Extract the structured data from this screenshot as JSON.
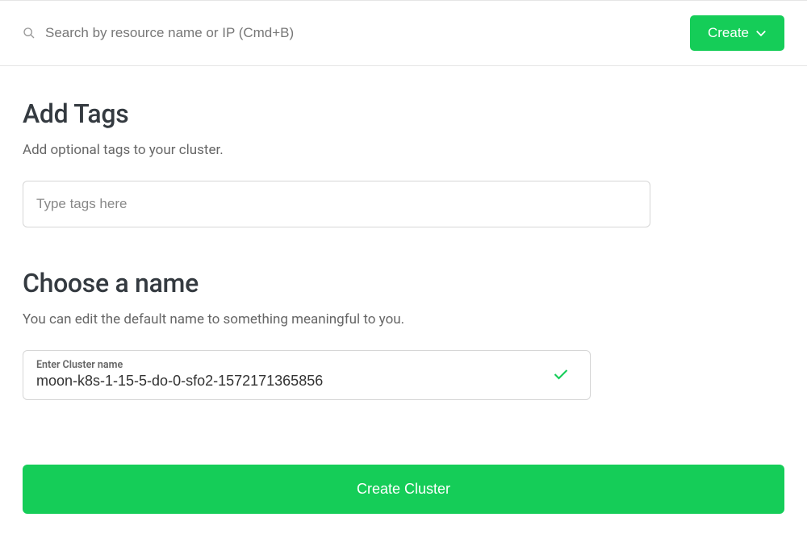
{
  "header": {
    "search_placeholder": "Search by resource name or IP (Cmd+B)",
    "create_label": "Create"
  },
  "tags_section": {
    "title": "Add Tags",
    "description": "Add optional tags to your cluster.",
    "input_placeholder": "Type tags here"
  },
  "name_section": {
    "title": "Choose a name",
    "description": "You can edit the default name to something meaningful to you.",
    "input_label": "Enter Cluster name",
    "input_value": "moon-k8s-1-15-5-do-0-sfo2-1572171365856"
  },
  "footer": {
    "create_cluster_label": "Create Cluster"
  }
}
